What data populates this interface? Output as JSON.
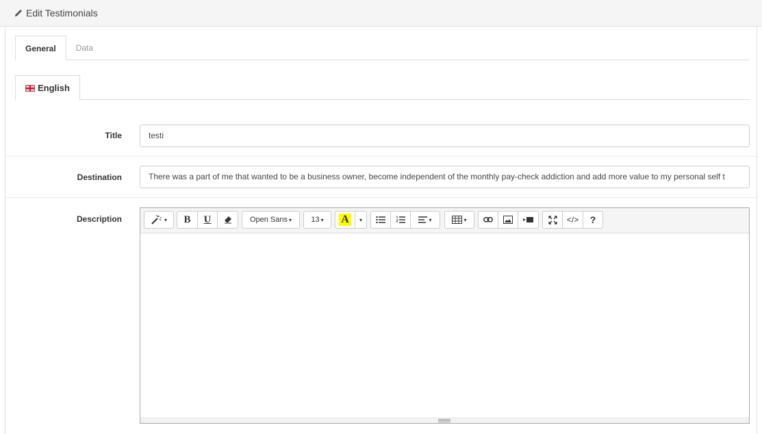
{
  "header": {
    "title": "Edit Testimonials",
    "icon": "pencil-icon"
  },
  "tabs": [
    {
      "label": "General",
      "active": true
    },
    {
      "label": "Data",
      "active": false
    }
  ],
  "language_tabs": [
    {
      "label": "English",
      "icon": "flag-uk-icon"
    }
  ],
  "form": {
    "title_label": "Title",
    "title_value": "testi",
    "destination_label": "Destination",
    "destination_value": "There was a part of me that wanted to be a business owner, become independent of the monthly pay-check addiction and add more value to my personal self t",
    "description_label": "Description"
  },
  "editor_toolbar": {
    "style_icon": "magic-wand-icon",
    "bold_label": "B",
    "underline_label": "U",
    "eraser_icon": "eraser-icon",
    "font_name": "Open Sans",
    "font_size": "13",
    "color_label": "A",
    "highlight_color": "#ffff00",
    "unordered_list_icon": "unordered-list-icon",
    "ordered_list_icon": "ordered-list-icon",
    "align_icon": "align-icon",
    "table_icon": "table-icon",
    "link_icon": "link-icon",
    "image_icon": "image-icon",
    "video_icon": "video-icon",
    "fullscreen_icon": "fullscreen-icon",
    "code_label": "</>",
    "help_label": "?"
  }
}
